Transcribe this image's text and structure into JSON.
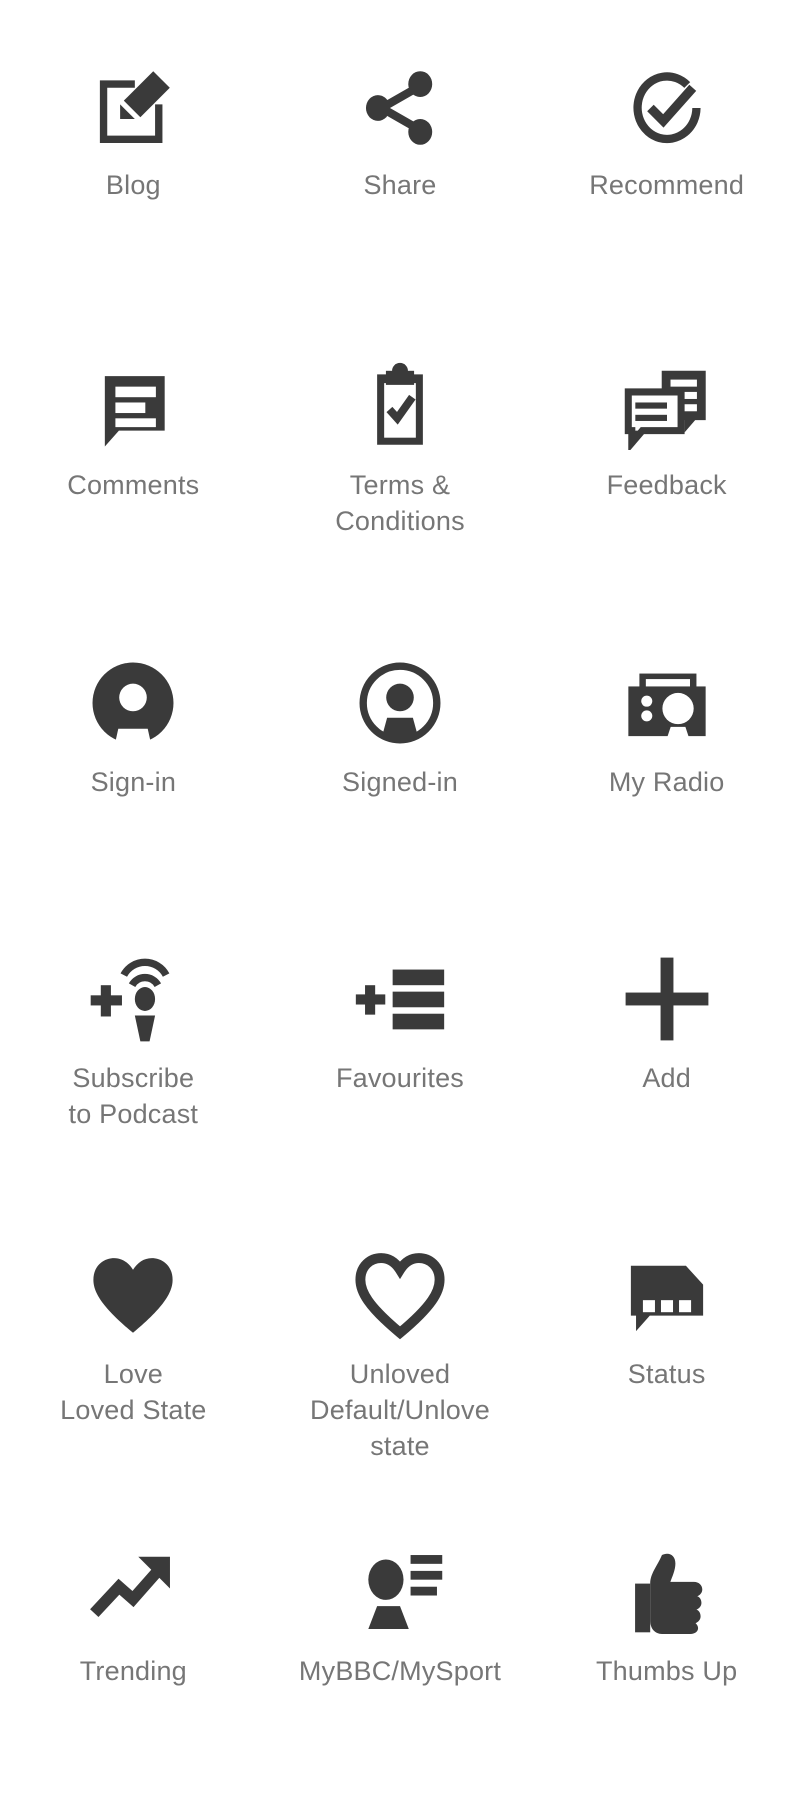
{
  "sheet": {
    "title": "Icon reference sheet",
    "background_color": "#ffffff",
    "icon_color": "#3a3a3a",
    "label_color": "#767676",
    "columns": 3,
    "rows": 6
  },
  "icons": [
    {
      "id": "blog",
      "label": "Blog",
      "icon": "blog-icon"
    },
    {
      "id": "share",
      "label": "Share",
      "icon": "share-icon"
    },
    {
      "id": "recommend",
      "label": "Recommend",
      "icon": "recommend-icon"
    },
    {
      "id": "comments",
      "label": "Comments",
      "icon": "comments-icon"
    },
    {
      "id": "terms",
      "label": "Terms &\nConditions",
      "icon": "clipboard-check-icon"
    },
    {
      "id": "feedback",
      "label": "Feedback",
      "icon": "feedback-icon"
    },
    {
      "id": "signin",
      "label": "Sign-in",
      "icon": "sign-in-icon"
    },
    {
      "id": "signedin",
      "label": "Signed-in",
      "icon": "signed-in-icon"
    },
    {
      "id": "myradio",
      "label": "My Radio",
      "icon": "radio-icon"
    },
    {
      "id": "podcast",
      "label": "Subscribe\nto Podcast",
      "icon": "subscribe-podcast-icon"
    },
    {
      "id": "favourites",
      "label": "Favourites",
      "icon": "favourites-icon"
    },
    {
      "id": "add",
      "label": "Add",
      "icon": "plus-icon"
    },
    {
      "id": "love",
      "label": "Love\nLoved State",
      "icon": "heart-filled-icon"
    },
    {
      "id": "unloved",
      "label": "Unloved\nDefault/Unlove\nstate",
      "icon": "heart-outline-icon"
    },
    {
      "id": "status",
      "label": "Status",
      "icon": "status-icon"
    },
    {
      "id": "trending",
      "label": "Trending",
      "icon": "trending-icon"
    },
    {
      "id": "mybbc",
      "label": "MyBBC/MySport",
      "icon": "mybbc-icon"
    },
    {
      "id": "thumbsup",
      "label": "Thumbs Up",
      "icon": "thumbs-up-icon"
    }
  ]
}
